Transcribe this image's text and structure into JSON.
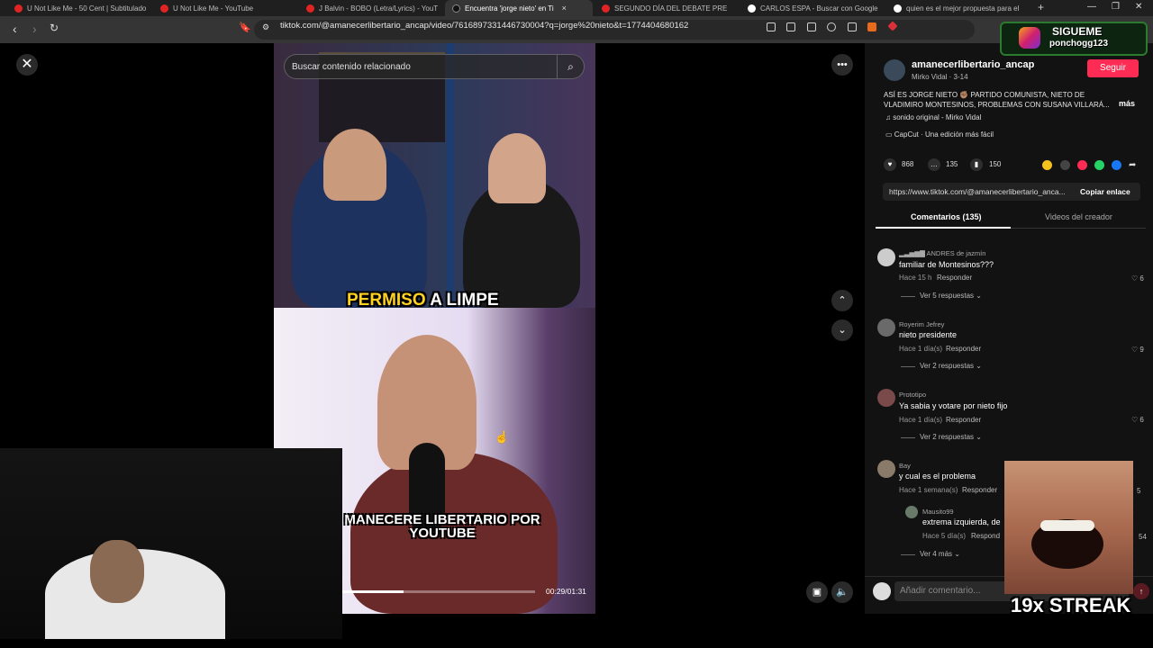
{
  "browser": {
    "tabs": [
      {
        "title": "U Not Like Me - 50 Cent | Subtitulado",
        "icon": "youtube-icon"
      },
      {
        "title": "U Not Like Me - YouTube",
        "icon": "youtube-icon"
      },
      {
        "title": "J Balvin - BOBO (Letra/Lyrics) - YouT",
        "icon": "youtube-icon"
      },
      {
        "title": "Encuentra 'jorge nieto' en Ti",
        "icon": "tiktok-icon",
        "active": true
      },
      {
        "title": "SEGUNDO DÍA DEL DEBATE PRE",
        "icon": "youtube-icon"
      },
      {
        "title": "CARLOS ESPA - Buscar con Google",
        "icon": "google-icon"
      },
      {
        "title": "quien es el mejor propuesta para el",
        "icon": "google-icon"
      }
    ],
    "url": "tiktok.com/@amanecerlibertario_ancap/video/7616897331446730004?q=jorge%20nieto&t=1774404680162"
  },
  "video": {
    "search_placeholder": "Buscar contenido relacionado",
    "caption_top_highlight": "PERMISO",
    "caption_top_rest": " A LIMPE",
    "caption_bottom": "MANECERE LIBERTARIO POR YOUTUBE",
    "time": "00:29/01:31",
    "progress_fraction": 0.32
  },
  "post": {
    "username": "amanecerlibertario_ancap",
    "subline": "Mirko Vidal · 3-14",
    "follow_label": "Seguir",
    "description": "ASÍ ES JORGE NIETO ✊🏽 PARTIDO COMUNISTA, NIETO DE VLADIMIRO MONTESINOS, PROBLEMAS CON SUSANA VILLARÁ...",
    "more_label": "más",
    "sound": "sonido original - Mirko Vidal",
    "capcut": "CapCut · Una edición más fácil",
    "likes": "868",
    "comments": "135",
    "saves": "150",
    "link": "https://www.tiktok.com/@amanecerlibertario_anca...",
    "copy_label": "Copiar enlace",
    "tab_comments": "Comentarios (135)",
    "tab_videos": "Videos del creador"
  },
  "comments": [
    {
      "user": "ANDRES de jazmín",
      "text": "familiar de Montesinos???",
      "time": "Hace 15 h",
      "reply": "Responder",
      "likes": "6",
      "more": "Ver 5 respuestas"
    },
    {
      "user": "Royerim Jefrey",
      "text": "nieto presidente",
      "time": "Hace 1 día(s)",
      "reply": "Responder",
      "likes": "9",
      "more": "Ver 2 respuestas"
    },
    {
      "user": "Prototipo",
      "text": "Ya sabia y votare por nieto fijo",
      "time": "Hace 1 día(s)",
      "reply": "Responder",
      "likes": "6",
      "more": "Ver 2 respuestas"
    },
    {
      "user": "Bay",
      "text": "y cual es el problema",
      "time": "Hace 1 semana(s)",
      "reply": "Responder",
      "likes": "5",
      "more": "Ver 4 más"
    }
  ],
  "reply": {
    "user": "Mausito99",
    "text": "extrema izquierda, de",
    "time": "Hace 5 día(s)",
    "reply": "Respond",
    "likes": "54"
  },
  "composer": {
    "placeholder": "Añadir comentario..."
  },
  "overlay": {
    "follow_title": "SIGUEME",
    "follow_handle": "ponchogg123",
    "streak": "19x STREAK"
  }
}
